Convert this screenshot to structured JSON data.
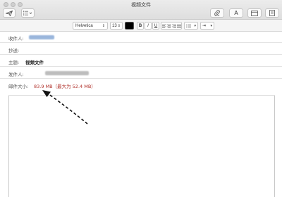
{
  "window": {
    "title": "视频文件"
  },
  "toolbar": {
    "send_icon": "paper-plane-icon",
    "list_icon": "list-icon",
    "attach_icon": "paperclip-icon",
    "font_icon_label": "A",
    "window_icon": "window-icon",
    "sidebar_icon": "sidebar-icon"
  },
  "format_bar": {
    "font_family": "Helvetica",
    "font_size": "13",
    "bold": "B",
    "italic": "I",
    "underline": "U",
    "text_color": "#000000"
  },
  "fields": {
    "to": {
      "label": "收件人:"
    },
    "cc": {
      "label": "抄送:"
    },
    "subject": {
      "label": "主题:",
      "value": "视频文件"
    },
    "from": {
      "label": "发件人:"
    },
    "size": {
      "label": "邮件大小:",
      "value": "83.9 MB（最大为 52.4 MB）"
    }
  },
  "colors": {
    "size_warning": "#b0302a",
    "arrow": "#111111"
  }
}
